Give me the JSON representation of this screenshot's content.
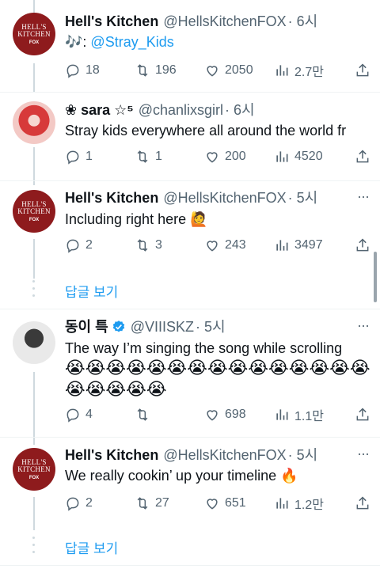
{
  "tweets": [
    {
      "name": "Hell's Kitchen",
      "handle": "@HellsKitchenFOX",
      "time": "· 6시",
      "text_prefix": "🎶: ",
      "mention": "@Stray_Kids",
      "reply": "18",
      "retweet": "196",
      "like": "2050",
      "views": "2.7만"
    },
    {
      "name": "❀ sara ☆⁵",
      "handle": "@chanlixsgirl",
      "time": "· 6시",
      "text": "Stray kids everywhere all around the world fr",
      "reply": "1",
      "retweet": "1",
      "like": "200",
      "views": "4520"
    },
    {
      "name": "Hell's Kitchen",
      "handle": "@HellsKitchenFOX",
      "time": "· 5시",
      "text": "Including right here 🙋",
      "reply": "2",
      "retweet": "3",
      "like": "243",
      "views": "3497"
    },
    {
      "name": "동이 특",
      "handle": "@VIIISKZ",
      "time": "· 5시",
      "text": "The way I’m singing the song while scrolling",
      "emojis": "😭😭😭😭😭😭😭😭😭😭😭😭😭😭😭😭😭😭😭😭",
      "reply": "4",
      "retweet": "",
      "like": "698",
      "views": "1.1만"
    },
    {
      "name": "Hell's Kitchen",
      "handle": "@HellsKitchenFOX",
      "time": "· 5시",
      "text": "We really cookin’ up your timeline 🔥",
      "reply": "2",
      "retweet": "27",
      "like": "651",
      "views": "1.2만"
    }
  ],
  "show_replies_label": "답글 보기",
  "hk_logo": {
    "line1": "HELL'S",
    "line2": "KITCHEN",
    "line3": "FOX"
  },
  "colors": {
    "accent": "#1d9bf0",
    "muted": "#536471",
    "hk_red": "#8e1b1d"
  },
  "icons": [
    "reply-icon",
    "retweet-icon",
    "like-icon",
    "views-icon",
    "share-icon",
    "more-icon",
    "verified-icon"
  ]
}
